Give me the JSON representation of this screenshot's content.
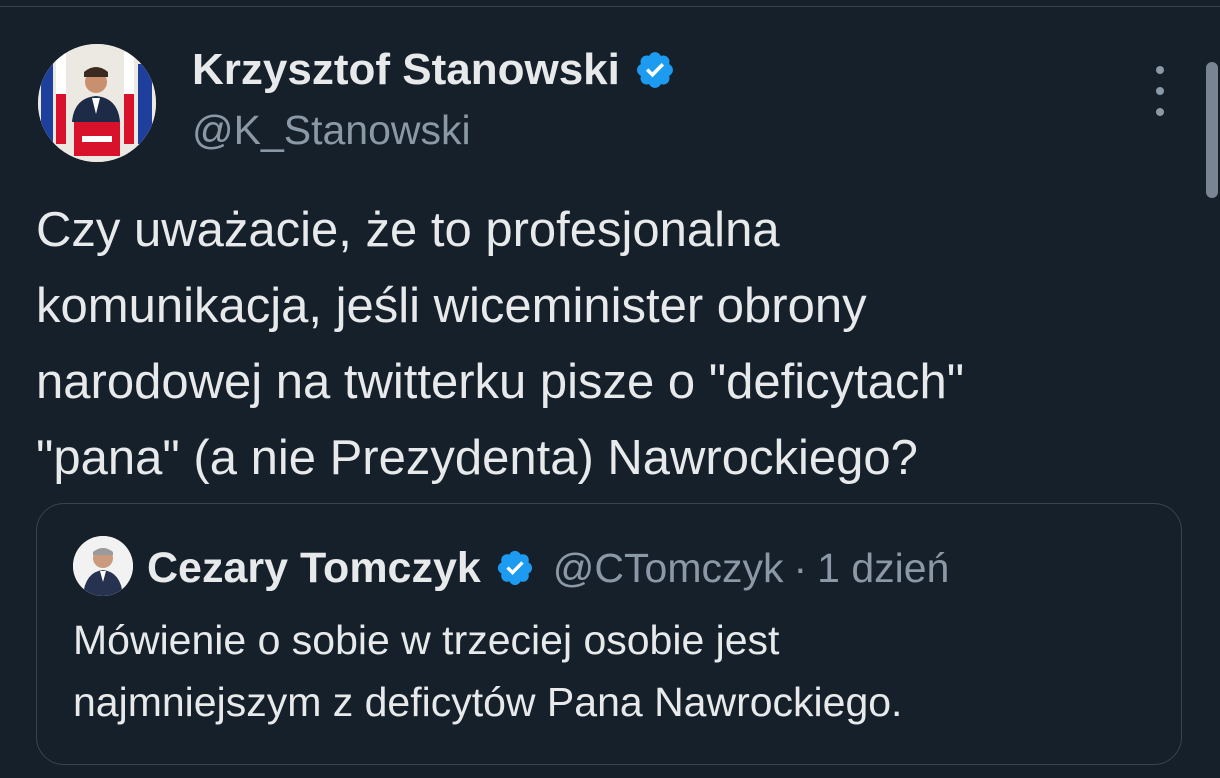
{
  "tweet": {
    "author_name": "Krzysztof Stanowski",
    "author_handle": "@K_Stanowski",
    "text": "Czy uważacie, że to profesjonalna\nkomunikacja, jeśli wiceminister obrony\nnarodowej na twitterku pisze o \"deficytach\"\n\"pana\" (a nie Prezydenta) Nawrockiego?"
  },
  "quoted": {
    "author_name": "Cezary Tomczyk",
    "author_handle": "@CTomczyk",
    "separator": "·",
    "time": "1 dzień",
    "text": "Mówienie o sobie w trzeciej osobie jest\nnajmniejszym z deficytów Pana Nawrockiego."
  },
  "icons": {
    "verified": "verified-badge-icon",
    "more": "more-options-icon"
  },
  "colors": {
    "background": "#15202b",
    "text": "#e7e9ea",
    "secondary": "#8b98a5",
    "verified": "#1d9bf0",
    "border": "#38444d"
  }
}
